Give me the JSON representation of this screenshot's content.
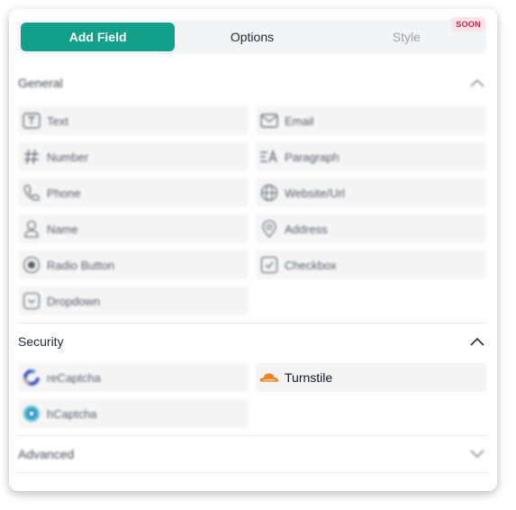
{
  "tabs": [
    {
      "label": "Add Field"
    },
    {
      "label": "Options"
    },
    {
      "label": "Style",
      "badge": "SOON"
    }
  ],
  "sections": {
    "general": {
      "title": "General",
      "fields": [
        "Text",
        "Email",
        "Number",
        "Paragraph",
        "Phone",
        "Website/Url",
        "Name",
        "Address",
        "Radio Button",
        "Checkbox",
        "Dropdown"
      ]
    },
    "security": {
      "title": "Security",
      "fields": [
        "reCaptcha",
        "Turnstile",
        "hCaptcha"
      ]
    },
    "advanced": {
      "title": "Advanced"
    }
  },
  "colors": {
    "accent": "#13a08a",
    "soon_badge_bg": "#fde4ea",
    "soon_badge_text": "#c0264b",
    "turnstile_orange": "#f48120",
    "recaptcha_blue": "#1c3aa9",
    "hcaptcha_teal": "#3fb9c8"
  },
  "icons": {
    "Text": "text-box-icon",
    "Email": "envelope-icon",
    "Number": "hash-icon",
    "Paragraph": "paragraph-icon",
    "Phone": "phone-icon",
    "Website/Url": "globe-icon",
    "Name": "person-icon",
    "Address": "map-pin-icon",
    "Radio Button": "radio-icon",
    "Checkbox": "checkbox-icon",
    "Dropdown": "dropdown-icon",
    "reCaptcha": "recaptcha-logo-icon",
    "Turnstile": "cloudflare-cloud-icon",
    "hCaptcha": "hcaptcha-logo-icon"
  }
}
